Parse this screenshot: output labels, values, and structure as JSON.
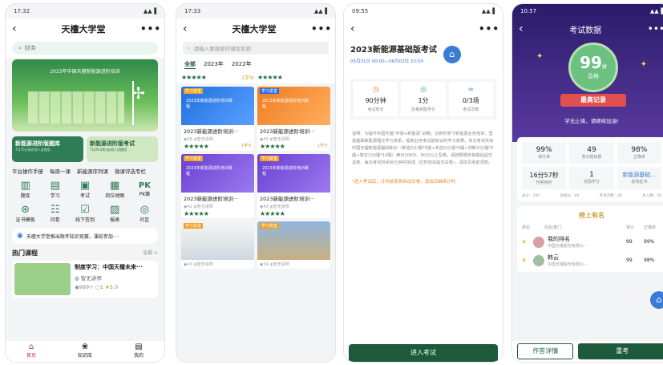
{
  "p1": {
    "time": "17:32",
    "title": "天檀大学堂",
    "search": "财务",
    "banner_title": "2023年中国天檀新能源进阶培训",
    "card1": {
      "title": "新能源进阶版题库",
      "sub": "7月25日前必须人员使用"
    },
    "card2": {
      "title": "新能源进阶版考试",
      "sub": "7月26·28日必须人员使用"
    },
    "tabs": [
      "平台操作手册",
      "每周一课",
      "新能源序列课",
      "微课评选专栏"
    ],
    "icons": [
      "题库",
      "学习",
      "考试",
      "岗位地图",
      "PK赛",
      "证书模板",
      "问卷",
      "线下签到",
      "报表",
      "社区"
    ],
    "notice": "天檀大学堂推出限年知识竞赛，课前参加····",
    "hot": "热门课程",
    "all": "全部 >",
    "course_title": "制度学习：中国天檀未来···",
    "course_author": "智无讲师",
    "views": "999+",
    "likes": "1",
    "rating": "5.0",
    "bottom": [
      "首页",
      "知识库",
      "我的"
    ]
  },
  "p2": {
    "time": "17:33",
    "title": "天檀大学堂",
    "search": "请输入要搜索的课程名称",
    "filters": [
      "全部",
      "2023年",
      "2022年"
    ],
    "courses": [
      {
        "title": "2023新能源进阶培训···",
        "views": "36",
        "author": "智无讲师",
        "score": "1学分"
      },
      {
        "title": "2023新能源进阶培训···",
        "views": "43",
        "author": "智无讲师",
        "score": "1学分"
      },
      {
        "title": "2023新能源进阶培训···",
        "views": "42",
        "author": "智无讲师",
        "score": ""
      },
      {
        "title": "2023新能源进阶培训···",
        "views": "43",
        "author": "智无讲师",
        "score": ""
      },
      {
        "title": "",
        "views": "43",
        "author": "智无讲师",
        "score": ""
      },
      {
        "title": "",
        "views": "54",
        "author": "智无讲师",
        "score": ""
      }
    ],
    "thumb_text": "2023年新能源进阶培训课程",
    "tag": "学习讲堂",
    "score_top": "1学分"
  },
  "p3": {
    "time": "09:55",
    "title": "2023新能源基础版考试",
    "date": "05月31日 00:00—06月02日 23:59",
    "stats": [
      {
        "value": "90分钟",
        "label": "考试时长"
      },
      {
        "value": "1分",
        "label": "及格奖励学分"
      },
      {
        "value": "0/3场",
        "label": "考试次数"
      }
    ],
    "desc": "说明：为提升中国天檀“环保+新能源”战略，在新形势下新能源业务培训，营造基础新能源理论学习体系，提高业务考试前知识的学习效果。本次考试共有中国天檀新能源基础知识（单选2分/题*5题+多选2分/题*5题+判断2分/题*5题+填空1分/题*10题）满分100分。60分以上及格，请按照顺序答题后提交试卷，每次考试时间90分钟内完成（过时自动提交试卷），具体见考前须知。",
    "warn": "*进入考试后，计时结束将自动交卷，退出后继续计时",
    "enter": "进入考试"
  },
  "p4": {
    "time": "10:57",
    "title": "考试数据",
    "score": "99",
    "score_unit": "分",
    "pass": "及格",
    "record": "最高记录",
    "slogan": "学无止境，请继续加油!",
    "grid": [
      {
        "value": "99%",
        "label": "得分率"
      },
      {
        "value": "49",
        "label": "答对题目数"
      },
      {
        "value": "98%",
        "label": "正确率"
      },
      {
        "value": "16分57秒",
        "label": "作答用时"
      },
      {
        "value": "1",
        "label": "奖励学分"
      },
      {
        "value": "新能源基础…",
        "label": "获得证书"
      }
    ],
    "footer": [
      "总分：100",
      "及格分：60",
      "考试次数：80",
      "总人数：50"
    ],
    "rank_title": "榜上有名",
    "rank_cols": [
      "排名",
      "姓名/部门",
      "得分",
      "正确率"
    ],
    "ranks": [
      {
        "name": "我的排名",
        "dept": "中国天檀股份有限公···",
        "score": "99",
        "rate": "99%"
      },
      {
        "name": "韩云",
        "dept": "中国天檀股份有限公···",
        "score": "99",
        "rate": "98%"
      }
    ],
    "btn_left": "作答详情",
    "btn_right": "重考"
  },
  "colors": {
    "green": "#1c5a3a",
    "purple": "#3a2a7a",
    "gold": "#c8a13a"
  }
}
